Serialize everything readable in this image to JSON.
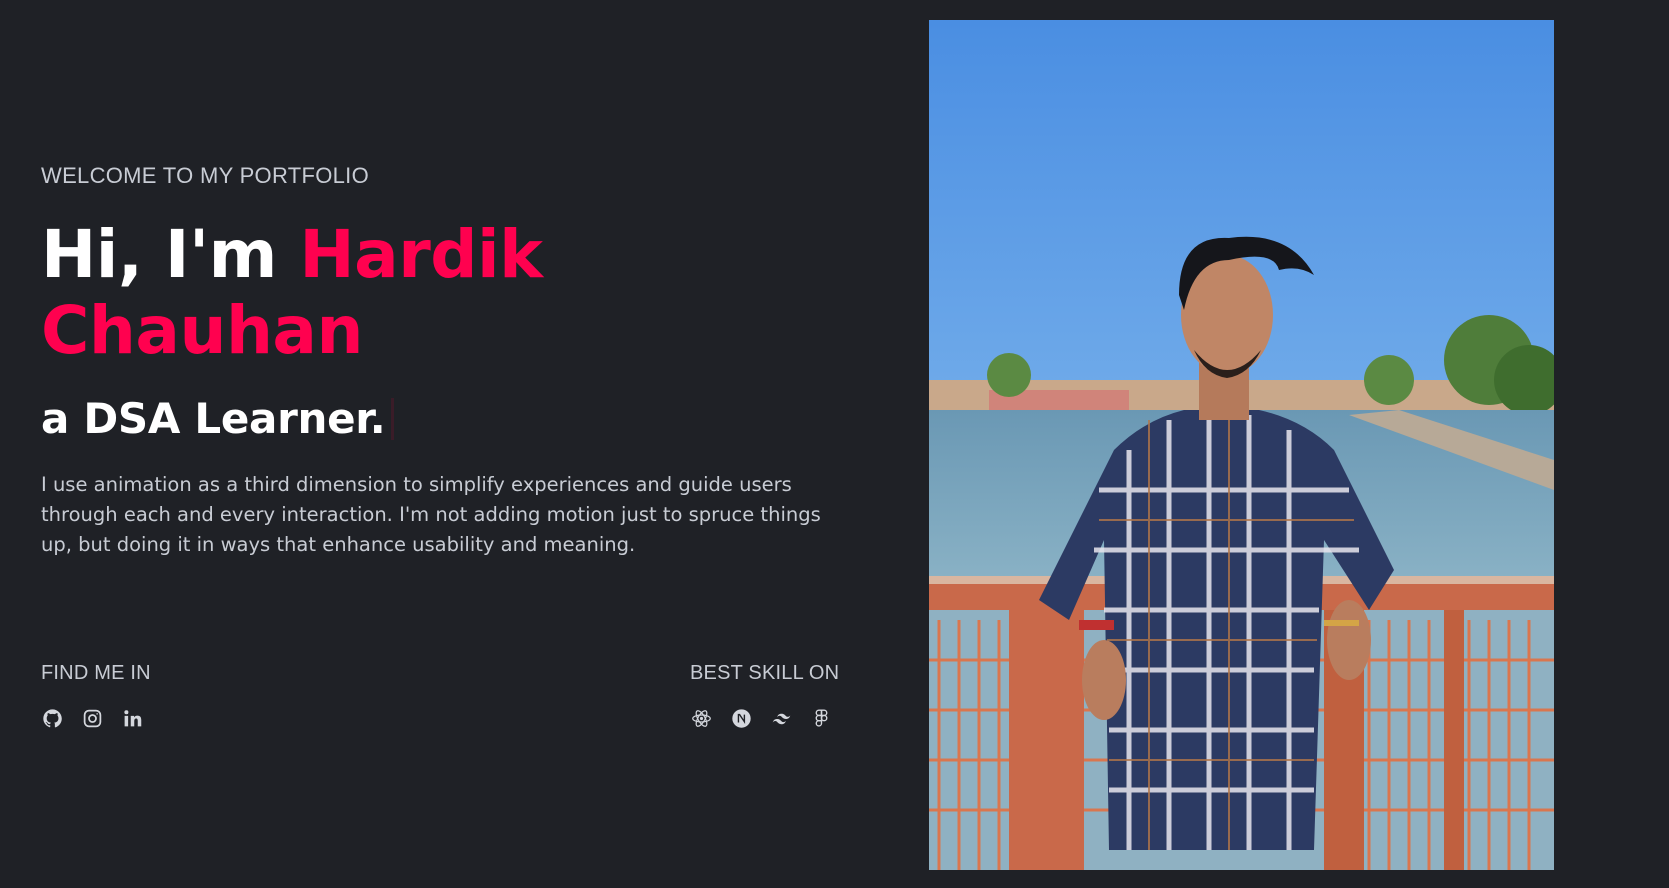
{
  "hero": {
    "welcome": "WELCOME TO MY PORTFOLIO",
    "greeting": "Hi, I'm ",
    "first_name": "Hardik",
    "last_name": "Chauhan",
    "role": "a DSA Learner.",
    "description": "I use animation as a third dimension to simplify experiences and guide users through each and every interaction. I'm not adding motion just to spruce things up, but doing it in ways that enhance usability and meaning."
  },
  "find_me": {
    "label": "FIND ME IN",
    "icons": [
      "github-icon",
      "instagram-icon",
      "linkedin-icon"
    ]
  },
  "skills": {
    "label": "BEST SKILL ON",
    "icons": [
      "react-icon",
      "nextjs-icon",
      "tailwind-icon",
      "figma-icon"
    ]
  },
  "colors": {
    "background": "#1f2126",
    "accent": "#ff014f",
    "text": "#c8ccd4",
    "heading": "#ffffff"
  }
}
